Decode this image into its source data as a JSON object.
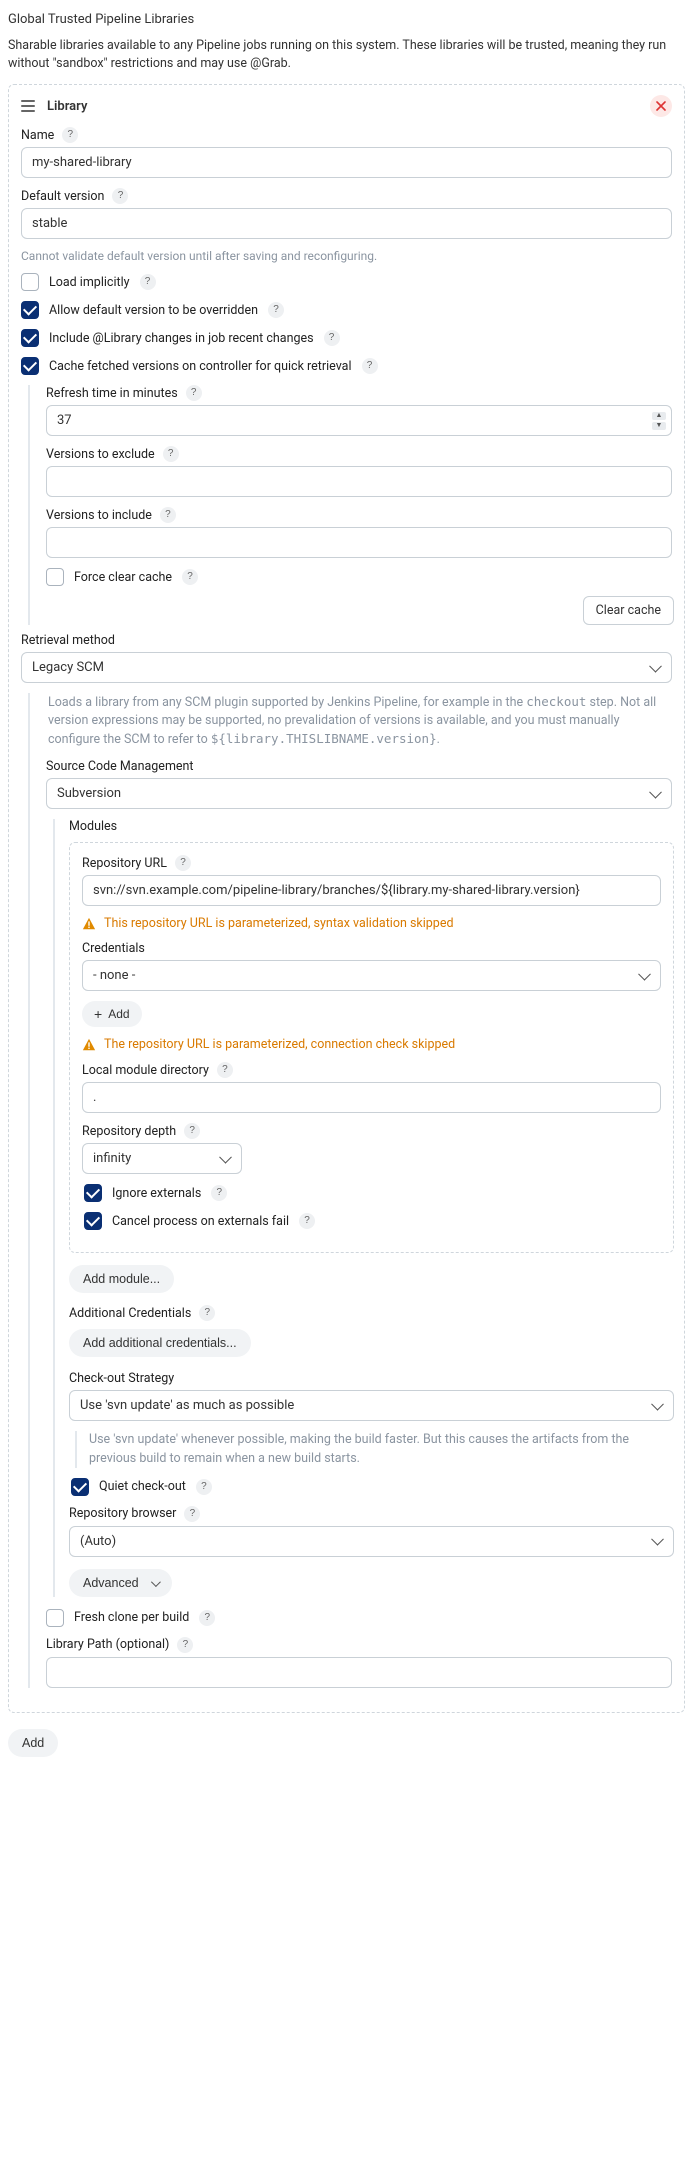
{
  "page": {
    "title": "Global Trusted Pipeline Libraries",
    "desc": "Sharable libraries available to any Pipeline jobs running on this system. These libraries will be trusted, meaning they run without \"sandbox\" restrictions and may use @Grab."
  },
  "library": {
    "header": "Library",
    "name_label": "Name",
    "name_value": "my-shared-library",
    "default_version_label": "Default version",
    "default_version_value": "stable",
    "default_version_hint": "Cannot validate default version until after saving and reconfiguring.",
    "load_implicitly": "Load implicitly",
    "allow_override": "Allow default version to be overridden",
    "include_changes": "Include @Library changes in job recent changes",
    "cache_versions": "Cache fetched versions on controller for quick retrieval",
    "cache": {
      "refresh_label": "Refresh time in minutes",
      "refresh_value": "37",
      "exclude_label": "Versions to exclude",
      "include_label": "Versions to include",
      "force_clear": "Force clear cache",
      "clear_btn": "Clear cache"
    }
  },
  "retrieval": {
    "label": "Retrieval method",
    "value": "Legacy SCM",
    "desc_1": "Loads a library from any SCM plugin supported by Jenkins Pipeline, for example in the ",
    "desc_code_1": "checkout",
    "desc_2": " step. Not all version expressions may be supported, no prevalidation of versions is available, and you must manually configure the SCM to refer to ",
    "desc_code_2": "${library.THISLIBNAME.version}",
    "desc_3": "."
  },
  "scm": {
    "label": "Source Code Management",
    "value": "Subversion",
    "modules_label": "Modules",
    "repo_url_label": "Repository URL",
    "repo_url_value": "svn://svn.example.com/pipeline-library/branches/${library.my-shared-library.version}",
    "repo_warn_1": "This repository URL is parameterized, syntax validation skipped",
    "credentials_label": "Credentials",
    "credentials_value": "- none -",
    "add_btn": "Add",
    "repo_warn_2": "The repository URL is parameterized, connection check skipped",
    "local_dir_label": "Local module directory",
    "local_dir_value": ".",
    "depth_label": "Repository depth",
    "depth_value": "infinity",
    "ignore_externals": "Ignore externals",
    "cancel_on_fail": "Cancel process on externals fail",
    "add_module_btn": "Add module...",
    "additional_cred_label": "Additional Credentials",
    "add_additional_cred_btn": "Add additional credentials...",
    "checkout_label": "Check-out Strategy",
    "checkout_value": "Use 'svn update' as much as possible",
    "checkout_desc": "Use 'svn update' whenever possible, making the build faster. But this causes the artifacts from the previous build to remain when a new build starts.",
    "quiet_checkout": "Quiet check-out",
    "repo_browser_label": "Repository browser",
    "repo_browser_value": "(Auto)",
    "advanced_btn": "Advanced",
    "fresh_clone": "Fresh clone per build",
    "library_path_label": "Library Path (optional)"
  },
  "footer": {
    "add_btn": "Add"
  }
}
